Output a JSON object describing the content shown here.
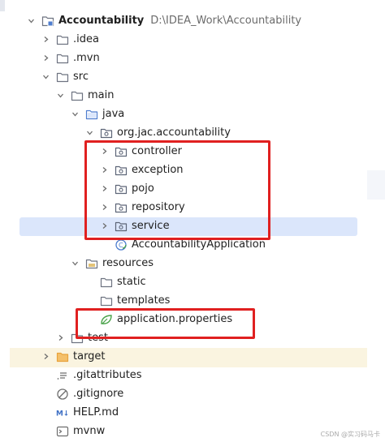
{
  "project": {
    "name": "Accountability",
    "path": "D:\\IDEA_Work\\Accountability"
  },
  "tree": [
    {
      "label": "Accountability",
      "indent": 0,
      "chevron": "down",
      "icon": "module-icon",
      "bold": true,
      "path": "D:\\IDEA_Work\\Accountability"
    },
    {
      "label": ".idea",
      "indent": 1,
      "chevron": "right",
      "icon": "folder-icon"
    },
    {
      "label": ".mvn",
      "indent": 1,
      "chevron": "right",
      "icon": "folder-icon"
    },
    {
      "label": "src",
      "indent": 1,
      "chevron": "down",
      "icon": "folder-icon"
    },
    {
      "label": "main",
      "indent": 2,
      "chevron": "down",
      "icon": "folder-icon"
    },
    {
      "label": "java",
      "indent": 3,
      "chevron": "down",
      "icon": "source-folder-icon"
    },
    {
      "label": "org.jac.accountability",
      "indent": 4,
      "chevron": "down",
      "icon": "package-icon"
    },
    {
      "label": "controller",
      "indent": 5,
      "chevron": "right",
      "icon": "package-icon"
    },
    {
      "label": "exception",
      "indent": 5,
      "chevron": "right",
      "icon": "package-icon"
    },
    {
      "label": "pojo",
      "indent": 5,
      "chevron": "right",
      "icon": "package-icon"
    },
    {
      "label": "repository",
      "indent": 5,
      "chevron": "right",
      "icon": "package-icon"
    },
    {
      "label": "service",
      "indent": 5,
      "chevron": "right",
      "icon": "package-icon",
      "selected": true
    },
    {
      "label": "AccountabilityApplication",
      "indent": 5,
      "chevron": "none",
      "icon": "spring-boot-class-icon"
    },
    {
      "label": "resources",
      "indent": 3,
      "chevron": "down",
      "icon": "resources-folder-icon"
    },
    {
      "label": "static",
      "indent": 4,
      "chevron": "none",
      "icon": "folder-icon"
    },
    {
      "label": "templates",
      "indent": 4,
      "chevron": "none",
      "icon": "folder-icon"
    },
    {
      "label": "application.properties",
      "indent": 4,
      "chevron": "none",
      "icon": "spring-properties-icon"
    },
    {
      "label": "test",
      "indent": 2,
      "chevron": "right",
      "icon": "folder-icon"
    },
    {
      "label": "target",
      "indent": 1,
      "chevron": "right",
      "icon": "excluded-folder-icon",
      "highlight": true
    },
    {
      "label": ".gitattributes",
      "indent": 1,
      "chevron": "none",
      "icon": "text-file-icon"
    },
    {
      "label": ".gitignore",
      "indent": 1,
      "chevron": "none",
      "icon": "ignore-file-icon"
    },
    {
      "label": "HELP.md",
      "indent": 1,
      "chevron": "none",
      "icon": "markdown-icon"
    },
    {
      "label": "mvnw",
      "indent": 1,
      "chevron": "none",
      "icon": "shell-file-icon"
    }
  ],
  "watermark": "CSDN @实习码马卡",
  "colors": {
    "selection": "#dbe6fb",
    "highlight": "#faf4e0",
    "annotation": "#e02020",
    "folder": "#6e7381",
    "package": "#5d6577",
    "spring": "#4aa34a",
    "excluded": "#e8a33d"
  }
}
